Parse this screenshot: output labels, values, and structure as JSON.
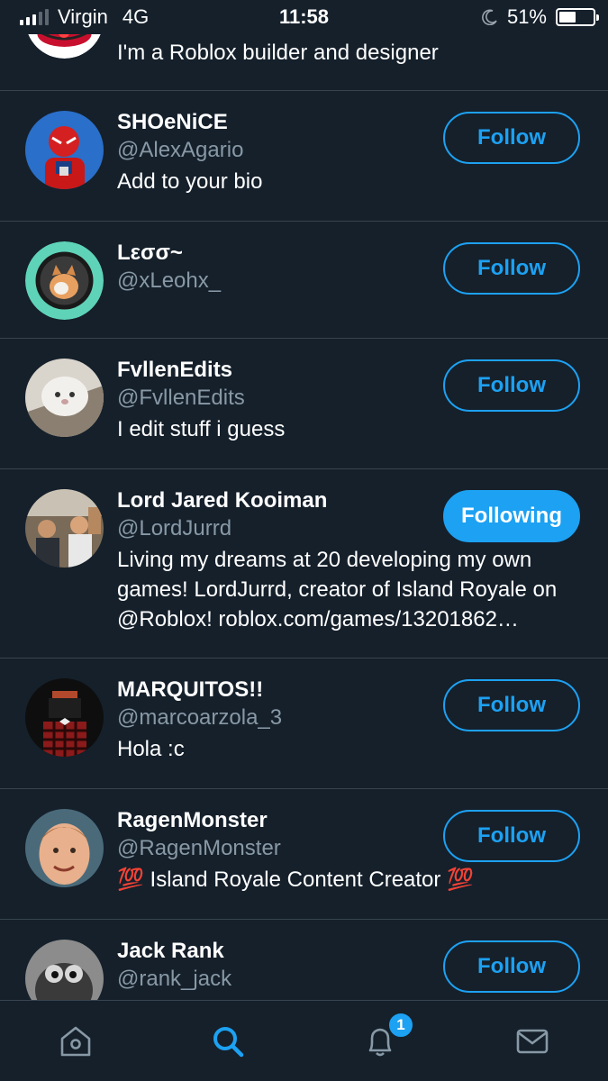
{
  "status_bar": {
    "carrier": "Virgin",
    "network": "4G",
    "time": "11:58",
    "battery_percent": "51%",
    "battery_level": 0.51,
    "icons": [
      "signal-icon",
      "moon-icon",
      "battery-icon"
    ]
  },
  "users": [
    {
      "name": "",
      "handle": "",
      "bio": "I'm a Roblox builder and designer",
      "button": ""
    },
    {
      "name": "SHOeNiCE",
      "handle": "@AlexAgario",
      "bio": "Add to your bio",
      "button": "Follow"
    },
    {
      "name": "Lεσσ~",
      "handle": "@xLeohx_",
      "bio": "",
      "button": "Follow"
    },
    {
      "name": "FvllenEdits",
      "handle": "@FvllenEdits",
      "bio": "I edit stuff i guess",
      "button": "Follow"
    },
    {
      "name": "Lord Jared Kooiman",
      "handle": "@LordJurrd",
      "bio": "Living my dreams at 20 developing my own games! LordJurrd, creator of Island Royale on @Roblox! roblox.com/games/13201862…",
      "button": "Following"
    },
    {
      "name": "MARQUITOS!!",
      "handle": "@marcoarzola_3",
      "bio": "Hola :c",
      "button": "Follow"
    },
    {
      "name": "RagenMonster",
      "handle": "@RagenMonster",
      "bio": "💯 Island Royale Content Creator 💯",
      "button": "Follow"
    },
    {
      "name": "Jack Rank",
      "handle": "@rank_jack",
      "bio": "",
      "button": "Follow"
    }
  ],
  "tab_bar": {
    "tabs": [
      "home-icon",
      "search-icon",
      "notifications-icon",
      "messages-icon"
    ],
    "active": "search-icon",
    "notification_badge": "1"
  },
  "colors": {
    "background": "#15202b",
    "accent": "#1da1f2",
    "secondary_text": "#8899a6",
    "divider": "#38444d"
  }
}
